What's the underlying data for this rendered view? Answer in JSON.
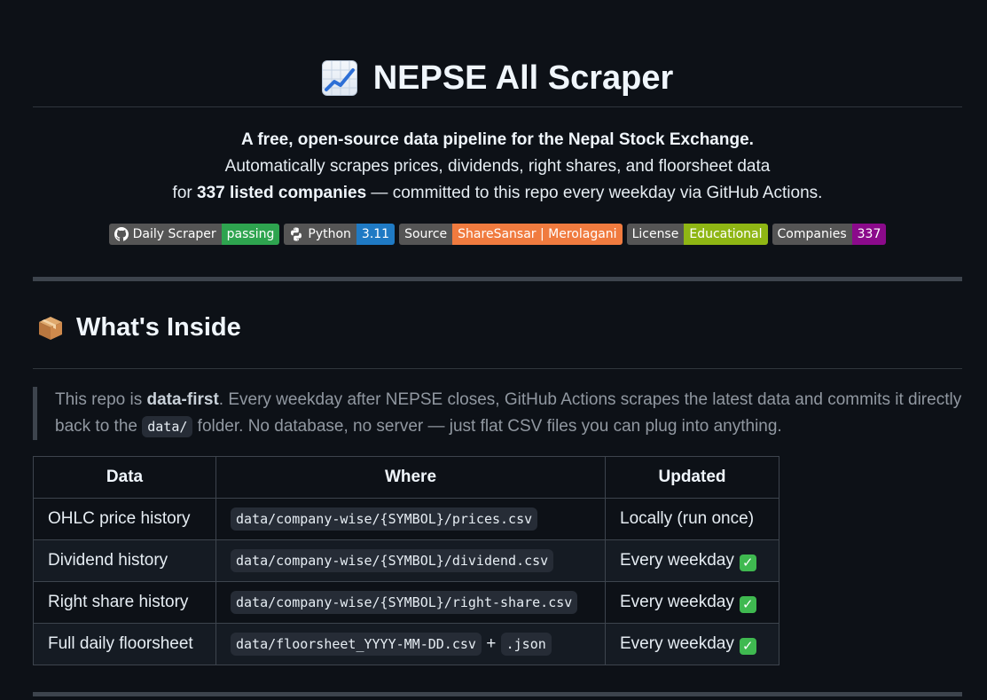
{
  "title": {
    "text": "NEPSE All Scraper",
    "emoji_icon": "chart-increasing-icon"
  },
  "intro": {
    "line1": "A free, open-source data pipeline for the Nepal Stock Exchange.",
    "line2": "Automatically scrapes prices, dividends, right shares, and floorsheet data",
    "line3_prefix": "for ",
    "line3_bold": "337 listed companies",
    "line3_suffix": " — committed to this repo every weekday via GitHub Actions."
  },
  "badges": [
    {
      "label": "Daily Scraper",
      "value": "passing",
      "icon": "github-icon",
      "color": "#2ea44f"
    },
    {
      "label": "Python",
      "value": "3.11",
      "icon": "python-icon",
      "color": "#1f7ac4"
    },
    {
      "label": "Source",
      "value": "ShareSansar | Merolagani",
      "icon": "",
      "color": "#f07b3f"
    },
    {
      "label": "License",
      "value": "Educational",
      "icon": "",
      "color": "#8fb614"
    },
    {
      "label": "Companies",
      "value": "337",
      "icon": "",
      "color": "#8b0a8b"
    }
  ],
  "section": {
    "title": "What's Inside",
    "emoji_icon": "package-icon"
  },
  "quote": {
    "part1": "This repo is ",
    "bold": "data-first",
    "part2": ". Every weekday after NEPSE closes, GitHub Actions scrapes the latest data and commits it directly back to the ",
    "code": "data/",
    "part3": " folder. No database, no server — just flat CSV files you can plug into anything."
  },
  "table": {
    "headers": [
      "Data",
      "Where",
      "Updated"
    ],
    "rows": [
      {
        "data": "OHLC price history",
        "where": "data/company-wise/{SYMBOL}/prices.csv",
        "where_extra": "",
        "updated": "Locally (run once)",
        "check": false
      },
      {
        "data": "Dividend history",
        "where": "data/company-wise/{SYMBOL}/dividend.csv",
        "where_extra": "",
        "updated": "Every weekday",
        "check": true
      },
      {
        "data": "Right share history",
        "where": "data/company-wise/{SYMBOL}/right-share.csv",
        "where_extra": "",
        "updated": "Every weekday",
        "check": true
      },
      {
        "data": "Full daily floorsheet",
        "where": "data/floorsheet_YYYY-MM-DD.csv",
        "where_extra": ".json",
        "updated": "Every weekday",
        "check": true
      }
    ],
    "plus": "+",
    "check_glyph": "✓"
  }
}
